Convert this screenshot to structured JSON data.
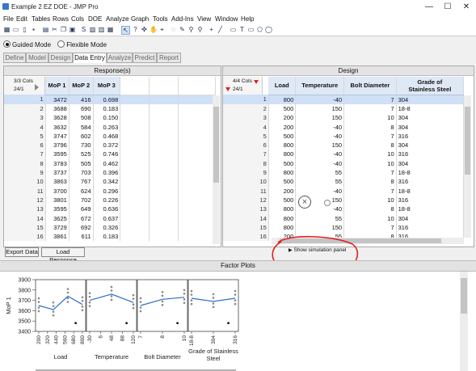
{
  "window": {
    "title": "Example 2 EZ DOE - JMP Pro",
    "buttons": [
      "—",
      "☐",
      "✕"
    ]
  },
  "menu": [
    "File",
    "Edit",
    "Tables",
    "Rows",
    "Cols",
    "DOE",
    "Analyze",
    "Graph",
    "Tools",
    "Add-Ins",
    "View",
    "Window",
    "Help"
  ],
  "modes": {
    "guided": "Guided Mode",
    "flexible": "Flexible Mode",
    "selected": "guided"
  },
  "tabs": [
    "Define",
    "Model",
    "Design",
    "Data Entry",
    "Analyze",
    "Predict",
    "Report"
  ],
  "active_tab": "Data Entry",
  "responses": {
    "title": "Response(s)",
    "cols_label": "3/3 Cols",
    "rows_label": "24/1",
    "headers": [
      "MoP 1",
      "MoP 2",
      "MoP 3"
    ],
    "rows": [
      [
        "1",
        "3472",
        "416",
        "0.698"
      ],
      [
        "2",
        "3688",
        "690",
        "0.183"
      ],
      [
        "3",
        "3628",
        "508",
        "0.150"
      ],
      [
        "4",
        "3632",
        "584",
        "0.263"
      ],
      [
        "5",
        "3747",
        "602",
        "0.468"
      ],
      [
        "6",
        "3796",
        "730",
        "0.372"
      ],
      [
        "7",
        "3595",
        "525",
        "0.746"
      ],
      [
        "8",
        "3783",
        "505",
        "0.462"
      ],
      [
        "9",
        "3737",
        "703",
        "0.396"
      ],
      [
        "10",
        "3863",
        "767",
        "0.342"
      ],
      [
        "11",
        "3700",
        "624",
        "0.296"
      ],
      [
        "12",
        "3801",
        "702",
        "0.226"
      ],
      [
        "13",
        "3595",
        "649",
        "0.636"
      ],
      [
        "14",
        "3625",
        "672",
        "0.637"
      ],
      [
        "15",
        "3729",
        "692",
        "0.326"
      ],
      [
        "16",
        "3861",
        "611",
        "0.183"
      ]
    ]
  },
  "design": {
    "title": "Design",
    "cols_label": "4/4 Cols",
    "rows_label": "24/1",
    "headers": [
      "Load",
      "Temperature",
      "Bolt Diameter",
      "Grade of Stainless Steel"
    ],
    "header_lines": [
      [
        "Load"
      ],
      [
        "Temperature"
      ],
      [
        "Bolt Diameter"
      ],
      [
        "Grade of",
        "Stainless Steel"
      ]
    ],
    "rows": [
      [
        "1",
        "800",
        "-40",
        "7",
        "304"
      ],
      [
        "2",
        "500",
        "150",
        "7",
        "18-8"
      ],
      [
        "3",
        "200",
        "150",
        "10",
        "304"
      ],
      [
        "4",
        "200",
        "-40",
        "8",
        "304"
      ],
      [
        "5",
        "500",
        "-40",
        "7",
        "316"
      ],
      [
        "6",
        "800",
        "150",
        "8",
        "304"
      ],
      [
        "7",
        "800",
        "-40",
        "10",
        "316"
      ],
      [
        "8",
        "500",
        "-40",
        "10",
        "304"
      ],
      [
        "9",
        "800",
        "55",
        "7",
        "18-8"
      ],
      [
        "10",
        "500",
        "55",
        "8",
        "316"
      ],
      [
        "11",
        "200",
        "-40",
        "7",
        "18-8"
      ],
      [
        "12",
        "500",
        "150",
        "10",
        "316"
      ],
      [
        "13",
        "800",
        "-40",
        "8",
        "18-8"
      ],
      [
        "14",
        "800",
        "55",
        "10",
        "304"
      ],
      [
        "15",
        "800",
        "150",
        "7",
        "316"
      ],
      [
        "16",
        "200",
        "55",
        "8",
        "316"
      ]
    ]
  },
  "buttons": {
    "export": "Export Data",
    "load": "Load Response"
  },
  "simulation": {
    "label": "Show simulation panel"
  },
  "factor_plots": {
    "title": "Factor Plots",
    "ylabel": "MoP 1",
    "panel_labels": [
      [
        "Load"
      ],
      [
        "Temperature"
      ],
      [
        "Bolt Diameter"
      ],
      [
        "Grade of Stainless",
        "Steel"
      ]
    ]
  },
  "chart_data": {
    "type": "line",
    "ylabel": "MoP 1",
    "ylim": [
      3400,
      3900
    ],
    "yticks": [
      3400,
      3500,
      3600,
      3700,
      3800,
      3900
    ],
    "panels": [
      {
        "factor": "Load",
        "ticks": [
          "200",
          "320",
          "440",
          "560",
          "680",
          "800"
        ],
        "x": [
          200,
          500,
          800
        ],
        "y": [
          3650,
          3610,
          3740,
          3660
        ]
      },
      {
        "factor": "Temperature",
        "ticks": [
          "-30",
          "6",
          "48",
          "88",
          "120"
        ],
        "x": [
          -40,
          55,
          150
        ],
        "y": [
          3700,
          3760,
          3680
        ]
      },
      {
        "factor": "Bolt Diameter",
        "ticks": [
          "7",
          "8",
          "10"
        ],
        "x": [
          7,
          8,
          10
        ],
        "y": [
          3650,
          3710,
          3730
        ]
      },
      {
        "factor": "Grade of Stainless Steel",
        "ticks": [
          "18-8",
          "304",
          "316"
        ],
        "x": [
          "18-8",
          "304",
          "316"
        ],
        "y": [
          3720,
          3690,
          3720
        ]
      }
    ]
  },
  "colors": {
    "selected_row": "#cfe0f7",
    "line": "#2a6fc9",
    "annotation": "#e02020"
  }
}
